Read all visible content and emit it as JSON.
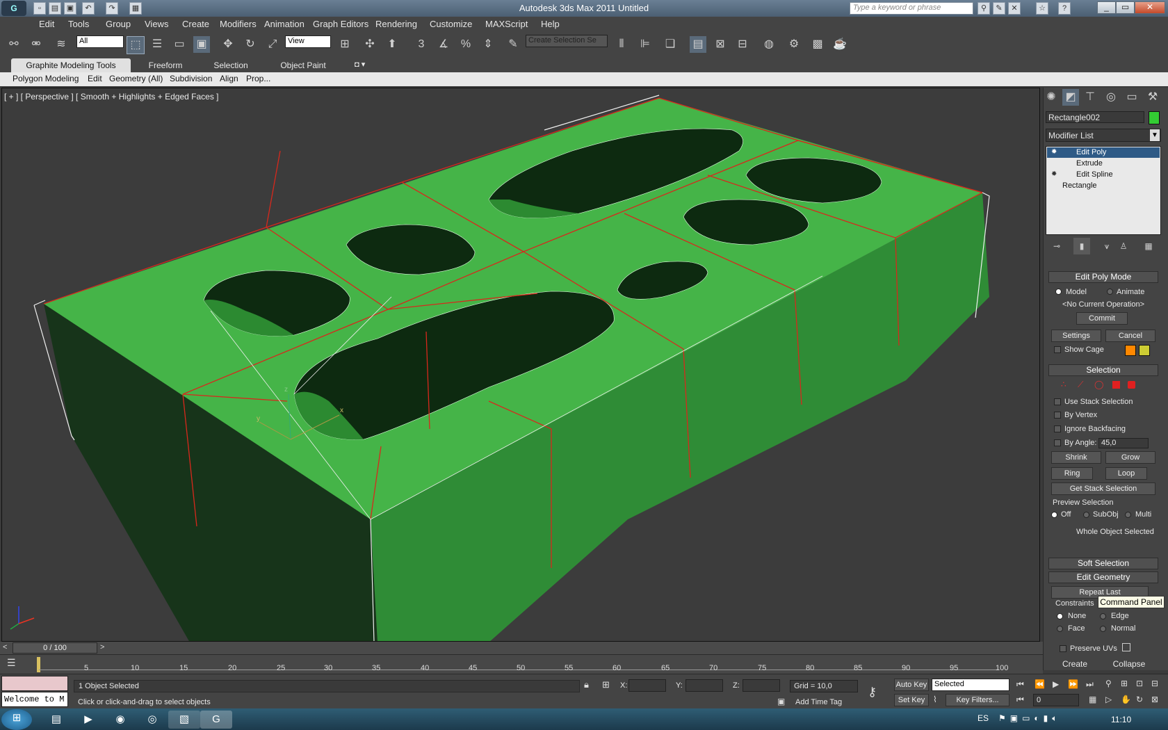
{
  "window": {
    "title": "Autodesk 3ds Max  2011     Untitled",
    "search_placeholder": "Type a keyword or phrase"
  },
  "menu": [
    "Edit",
    "Tools",
    "Group",
    "Views",
    "Create",
    "Modifiers",
    "Animation",
    "Graph Editors",
    "Rendering",
    "Customize",
    "MAXScript",
    "Help"
  ],
  "toolbar": {
    "filter_value": "All",
    "coord_value": "View",
    "selection_set_placeholder": "Create Selection Se"
  },
  "ribbon": {
    "tabs": [
      "Graphite Modeling Tools",
      "Freeform",
      "Selection",
      "Object Paint"
    ],
    "subtabs": [
      "Polygon Modeling",
      "Edit",
      "Geometry (All)",
      "Subdivision",
      "Align",
      "Prop..."
    ]
  },
  "viewport": {
    "label": "[ + ] [ Perspective ] [ Smooth + Highlights + Edged Faces ]",
    "gizmo_labels": [
      "z",
      "y",
      "x"
    ]
  },
  "command_panel": {
    "object_name": "Rectangle002",
    "object_color": "#33cc33",
    "modifier_list": "Modifier List",
    "stack": [
      "Edit Poly",
      "Extrude",
      "Edit Spline",
      "Rectangle"
    ],
    "edit_poly_mode": {
      "title": "Edit Poly Mode",
      "model": "Model",
      "animate": "Animate",
      "current_op": "<No Current Operation>",
      "commit": "Commit",
      "settings": "Settings",
      "cancel": "Cancel",
      "show_cage": "Show Cage"
    },
    "selection": {
      "title": "Selection",
      "use_stack": "Use Stack Selection",
      "by_vertex": "By Vertex",
      "ignore_backfacing": "Ignore Backfacing",
      "by_angle": "By Angle:",
      "angle_value": "45,0",
      "shrink": "Shrink",
      "grow": "Grow",
      "ring": "Ring",
      "loop": "Loop",
      "get_stack": "Get Stack Selection",
      "preview_title": "Preview Selection",
      "preview_off": "Off",
      "preview_subobj": "SubObj",
      "preview_multi": "Multi",
      "whole_object": "Whole Object Selected"
    },
    "soft_selection": "Soft Selection",
    "edit_geometry": "Edit Geometry",
    "repeat_last": "Repeat Last",
    "constraints": {
      "title": "Constraints",
      "none": "None",
      "edge": "Edge",
      "face": "Face",
      "normal": "Normal"
    },
    "preserve_uvs": "Preserve UVs",
    "create": "Create",
    "collapse": "Collapse"
  },
  "tooltip": "Command Panel",
  "timeline": {
    "frame": "0 / 100",
    "ticks": [
      "5",
      "10",
      "15",
      "20",
      "25",
      "30",
      "35",
      "40",
      "45",
      "50",
      "55",
      "60",
      "65",
      "70",
      "75",
      "80",
      "85",
      "90",
      "95",
      "100"
    ]
  },
  "status": {
    "selected": "1 Object Selected",
    "prompt": "Click or click-and-drag to select objects",
    "welcome": "Welcome to M",
    "x_label": "X:",
    "y_label": "Y:",
    "z_label": "Z:",
    "grid": "Grid = 10,0",
    "add_time_tag": "Add Time Tag",
    "auto_key": "Auto Key",
    "set_key": "Set Key",
    "key_mode": "Selected",
    "key_filters": "Key Filters...",
    "frame_value": "0"
  },
  "taskbar": {
    "lang": "ES",
    "clock": "11:10"
  }
}
